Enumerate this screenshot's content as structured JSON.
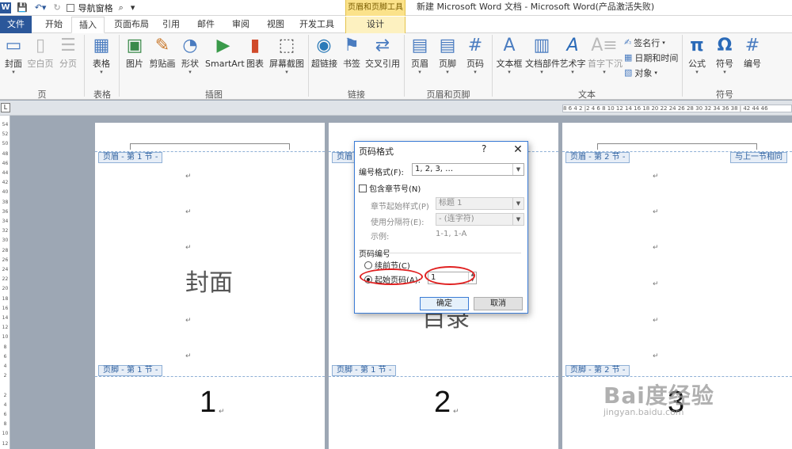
{
  "titlebar": {
    "nav_pane_label": "导航窗格",
    "context_tab_group": "页眉和页脚工具",
    "window_title": "新建 Microsoft Word 文档 - Microsoft Word(产品激活失败)"
  },
  "tabs": [
    "文件",
    "开始",
    "插入",
    "页面布局",
    "引用",
    "邮件",
    "审阅",
    "视图",
    "开发工具",
    "设计"
  ],
  "ribbon": {
    "buttons": {
      "cover": "封面",
      "blank": "空白页",
      "pagebreak": "分页",
      "table": "表格",
      "picture": "图片",
      "clipart": "剪贴画",
      "shapes": "形状",
      "smartart": "SmartArt",
      "chart": "图表",
      "screenshot": "屏幕截图",
      "hyperlink": "超链接",
      "bookmark": "书签",
      "crossref": "交叉引用",
      "header": "页眉",
      "footer": "页脚",
      "pagenum": "页码",
      "textbox": "文本框",
      "quickparts": "文档部件",
      "wordart": "艺术字",
      "dropcap": "首字下沉",
      "signature": "签名行",
      "datetime": "日期和时间",
      "object": "对象",
      "equation": "公式",
      "symbol": "符号",
      "number": "编号"
    },
    "groups": {
      "pages": "页",
      "tables": "表格",
      "illustrations": "插图",
      "links": "链接",
      "header_footer": "页眉和页脚",
      "text": "文本",
      "symbols": "符号"
    }
  },
  "ruler": {
    "h_ticks": "8 6 4 2 |2 4 6 8 10 12 14 16 18 20 22 24 26 28 30 32 34 36 38 | 42 44 46",
    "v_ticks": [
      "54",
      "52",
      "50",
      "48",
      "46",
      "44",
      "42",
      "40",
      "38",
      "36",
      "34",
      "32",
      "30",
      "28",
      "26",
      "24",
      "22",
      "20",
      "18",
      "16",
      "14",
      "12",
      "10",
      "8",
      "6",
      "4",
      "2",
      "",
      "2",
      "4",
      "6",
      "8",
      "10",
      "12"
    ]
  },
  "pages": [
    {
      "header_tag": "页眉 - 第 1 节 -",
      "footer_tag": "页脚 - 第 1 节 -",
      "body_text": "封面",
      "page_number": "1"
    },
    {
      "header_tag": "页眉 - 第 1 节 -",
      "footer_tag": "页脚 - 第 1 节 -",
      "body_text": "目录",
      "page_number": "2"
    },
    {
      "header_tag": "页眉 - 第 2 节 -",
      "footer_tag": "页脚 - 第 2 节 -",
      "same_as_prev": "与上一节相同",
      "page_number": "3"
    }
  ],
  "para_mark": "↵",
  "dialog": {
    "title": "页码格式",
    "help": "?",
    "close": "✕",
    "number_format_label": "编号格式(F):",
    "number_format_value": "1, 2, 3, …",
    "include_chapter_label": "包含章节号(N)",
    "chapter_style_label": "章节起始样式(P)",
    "chapter_style_value": "标题 1",
    "separator_label": "使用分隔符(E):",
    "separator_value": "-  (连字符)",
    "example_label": "示例:",
    "example_value": "1-1, 1-A",
    "section_label": "页码编号",
    "continue_label": "续前节(C)",
    "start_at_label": "起始页码(A):",
    "start_at_value": "1",
    "ok": "确定",
    "cancel": "取消"
  },
  "watermark": {
    "main": "Bai度经验",
    "sub": "jingyan.baidu.com"
  }
}
